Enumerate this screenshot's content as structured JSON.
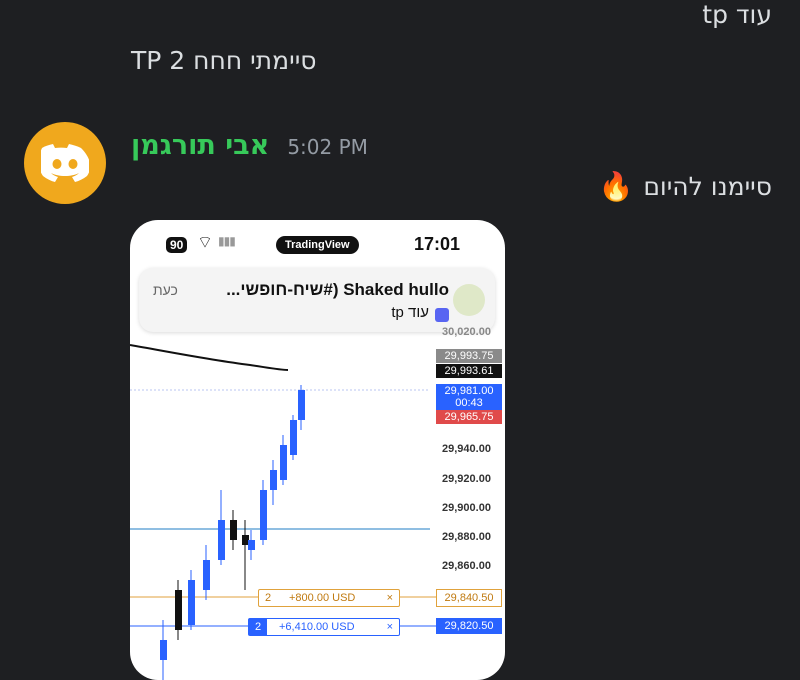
{
  "messages": {
    "m1": "עוד tp",
    "m2": "סיימתי חחח TP 2",
    "m3": "סיימנו להיום"
  },
  "author": {
    "name": "אבי תורגמן",
    "time": "5:02 PM",
    "avatar_icon": "discord-logo-icon"
  },
  "fire_emoji": "🔥",
  "screenshot": {
    "battery": "90",
    "app_pill": "TradingView",
    "clock": "17:01",
    "notification": {
      "title": "Shaked hullo (#שיח-חופשי...",
      "when": "כעת",
      "body": "עוד tp"
    },
    "partial_price": "30,020.00",
    "price_tags": {
      "p1": "29,993.75",
      "p2": "29,993.61",
      "p3": "29,981.00",
      "p3_timer": "00:43",
      "p4": "29,965.75"
    },
    "axis_labels": [
      "29,940.00",
      "29,920.00",
      "29,900.00",
      "29,880.00",
      "29,860.00"
    ],
    "orders": [
      {
        "qty": "2",
        "amount": "+800.00 USD",
        "close": "×",
        "price": "29,840.50"
      },
      {
        "qty": "2",
        "amount": "+6,410.00 USD",
        "close": "×",
        "price": "29,820.50"
      }
    ],
    "colors": {
      "up": "#2962ff",
      "down": "#111111",
      "order1": "#e0a23c",
      "order2": "#2962ff",
      "sell_tag": "#e04a4a"
    }
  }
}
